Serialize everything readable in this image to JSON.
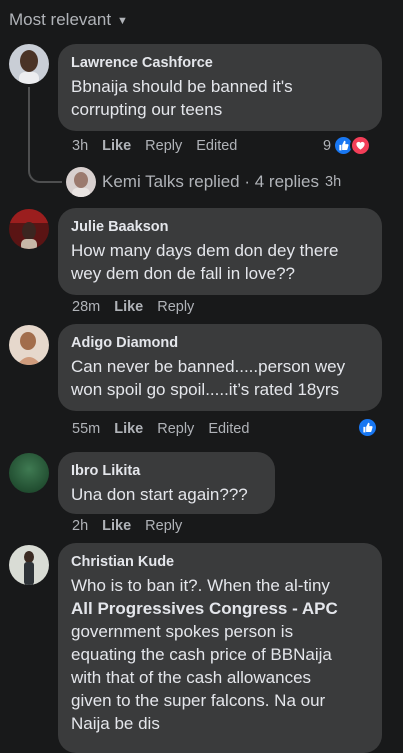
{
  "sort": {
    "label": "Most relevant"
  },
  "comments": [
    {
      "author": "Lawrence Cashforce",
      "line1": "Bbnaija should be banned it's",
      "line2": "corrupting our teens",
      "time": "3h",
      "like": "Like",
      "reply": "Reply",
      "edited": "Edited",
      "reaction_count": "9",
      "reactions": [
        "like-icon",
        "love-icon"
      ]
    },
    {
      "author": "Julie Baakson",
      "line1": "How many days dem don dey there",
      "line2": "wey dem don de fall in love??",
      "time": "28m",
      "like": "Like",
      "reply": "Reply"
    },
    {
      "author": "Adigo Diamond",
      "line1": "Can never be banned.....person wey",
      "line2": "won spoil go spoil.....it’s rated 18yrs",
      "time": "55m",
      "like": "Like",
      "reply": "Reply",
      "edited": "Edited",
      "reactions": [
        "like-icon"
      ]
    },
    {
      "author": "Ibro Likita",
      "line1": "Una don start again???",
      "time": "2h",
      "like": "Like",
      "reply": "Reply"
    },
    {
      "author": "Christian Kude",
      "line1": "Who is to ban it?. When the al-tiny",
      "line2": "All Progressives Congress - APC",
      "line3": "government spokes person is",
      "line4": "equating the cash price of BBNaija",
      "line5": "with that of the cash allowances",
      "line6": "given to the super falcons. Na our",
      "line7": "Naija be dis"
    }
  ],
  "replies_summary": {
    "name": "Kemi Talks",
    "text": "Kemi Talks replied · 4 replies",
    "time": "3h"
  },
  "colors": {
    "background": "#18191a",
    "bubble": "#3a3b3c",
    "secondary_text": "#b0b3b8",
    "like_blue": "#1877f2",
    "love_red": "#f33e58"
  }
}
